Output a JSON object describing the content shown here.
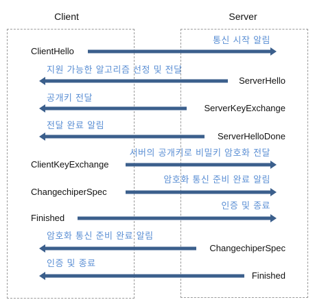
{
  "participants": {
    "client": "Client",
    "server": "Server"
  },
  "colors": {
    "arrow": "#3b5f8c",
    "annotation": "#5b8fd4",
    "border": "#9a9a9a"
  },
  "messages": [
    {
      "label": "ClientHello",
      "note": "통신 시작 알림",
      "direction": "client-to-server"
    },
    {
      "label": "ServerHello",
      "note": "지원 가능한 알고리즘 선정 및 전달",
      "direction": "server-to-client"
    },
    {
      "label": "ServerKeyExchange",
      "note": "공개키 전달",
      "direction": "server-to-client"
    },
    {
      "label": "ServerHelloDone",
      "note": "전달 완료 알림",
      "direction": "server-to-client"
    },
    {
      "label": "ClientKeyExchange",
      "note": "서버의 공개키로 비밀키 암호화 전달",
      "direction": "client-to-server"
    },
    {
      "label": "ChangechiperSpec",
      "note": "암호화 통신 준비 완료 알림",
      "direction": "client-to-server"
    },
    {
      "label": "Finished",
      "note": "인증 및 종료",
      "direction": "client-to-server"
    },
    {
      "label": "ChangechiperSpec",
      "note": "암호화 통신 준비 완료 알림",
      "direction": "server-to-client"
    },
    {
      "label": "Finished",
      "note": "인증 및 종료",
      "direction": "server-to-client"
    }
  ]
}
